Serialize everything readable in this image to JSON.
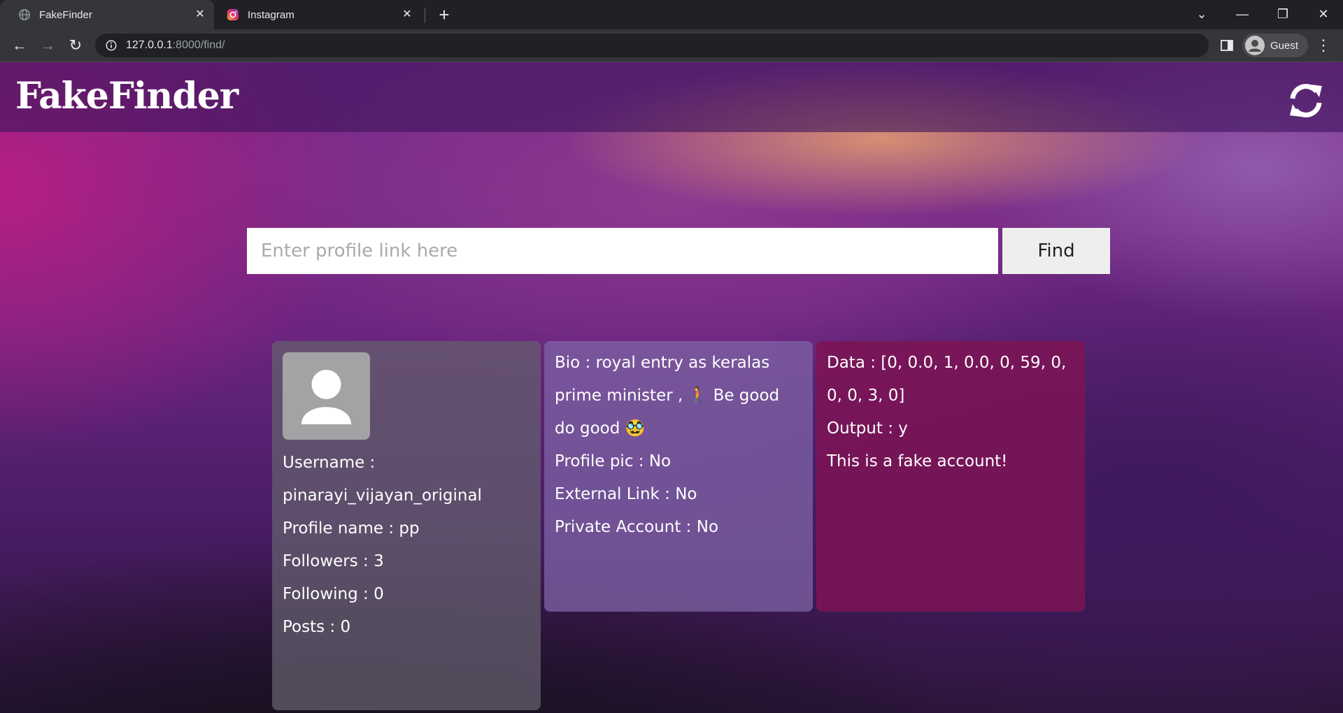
{
  "browser": {
    "tabs": [
      {
        "title": "FakeFinder",
        "icon": "globe-icon",
        "active": true
      },
      {
        "title": "Instagram",
        "icon": "instagram-icon",
        "active": false
      }
    ],
    "url_host": "127.0.0.1",
    "url_path": ":8000/find/",
    "profile_label": "Guest"
  },
  "app": {
    "brand": "FakeFinder",
    "refresh_icon": "refresh-icon"
  },
  "search": {
    "placeholder": "Enter profile link here",
    "value": "",
    "button_label": "Find"
  },
  "profile_card": {
    "avatar_icon": "user-avatar-icon",
    "username_label": "Username :",
    "username": "pinarayi_vijayan_original",
    "profile_name": "Profile name : pp",
    "followers": "Followers : 3",
    "following": "Following : 0",
    "posts": "Posts : 0"
  },
  "details_card": {
    "bio": "Bio : royal entry as keralas prime minister , 🚶 Be good do good 🥸",
    "profile_pic": "Profile pic : No",
    "external_link": "External Link : No",
    "private_account": "Private Account : No"
  },
  "result_card": {
    "data": "Data : [0, 0.0, 1, 0.0, 0, 59, 0, 0, 0, 3, 0]",
    "output": "Output : y",
    "verdict": "This is a fake account!"
  },
  "colors": {
    "result_card_bg": "#7d1455",
    "bio_card_bg": "#7d64a5",
    "profile_card_bg": "#645f6e"
  }
}
